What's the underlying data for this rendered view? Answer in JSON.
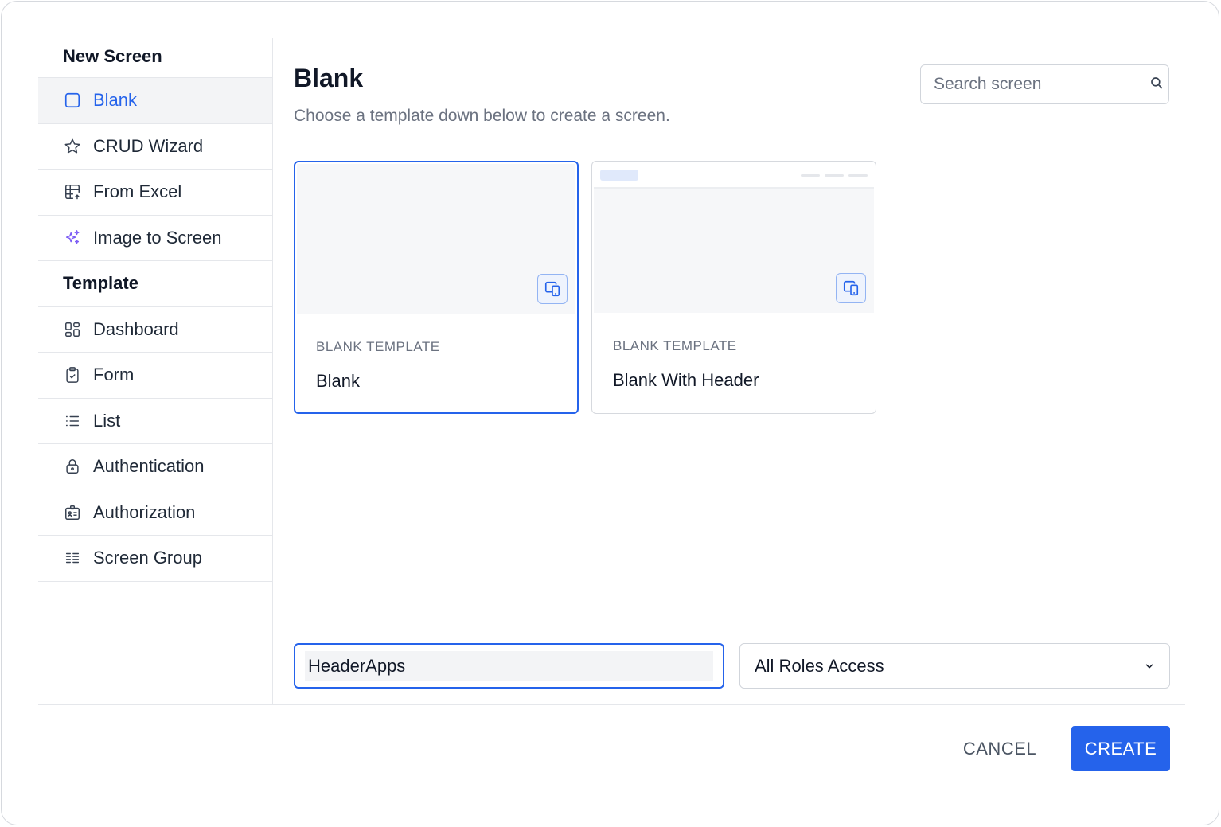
{
  "sidebar": {
    "header": "New Screen",
    "items": [
      {
        "label": "Blank",
        "icon": "square-icon",
        "active": true
      },
      {
        "label": "CRUD Wizard",
        "icon": "star-icon"
      },
      {
        "label": "From Excel",
        "icon": "table-icon"
      },
      {
        "label": "Image to Screen",
        "icon": "sparkle-icon"
      }
    ],
    "template_section": "Template",
    "template_items": [
      {
        "label": "Dashboard",
        "icon": "dashboard-icon"
      },
      {
        "label": "Form",
        "icon": "clipboard-icon"
      },
      {
        "label": "List",
        "icon": "list-icon"
      },
      {
        "label": "Authentication",
        "icon": "lock-icon"
      },
      {
        "label": "Authorization",
        "icon": "id-card-icon"
      },
      {
        "label": "Screen Group",
        "icon": "grouped-list-icon"
      }
    ]
  },
  "main": {
    "title": "Blank",
    "subtitle": "Choose a template down below to create a screen.",
    "search_placeholder": "Search screen",
    "cards": [
      {
        "category": "BLANK TEMPLATE",
        "name": "Blank",
        "selected": true
      },
      {
        "category": "BLANK TEMPLATE",
        "name": "Blank With Header",
        "selected": false
      }
    ],
    "screen_name_value": "HeaderApps",
    "role_value": "All Roles Access"
  },
  "footer": {
    "cancel_label": "CANCEL",
    "create_label": "CREATE"
  },
  "colors": {
    "accent": "#2563eb",
    "sparkle": "#7c5cf5"
  }
}
